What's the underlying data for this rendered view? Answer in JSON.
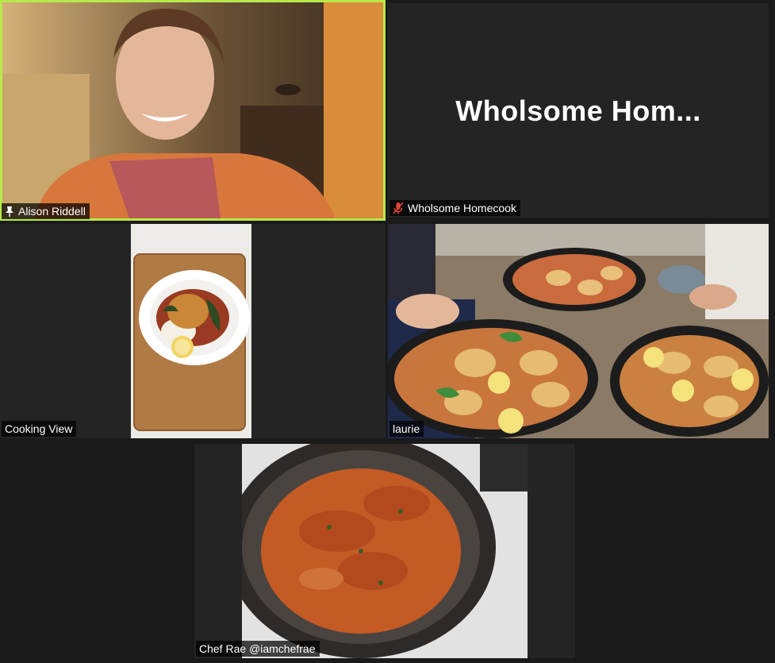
{
  "participants": [
    {
      "name": "Alison Riddell",
      "pinned": true,
      "active_speaker": true,
      "icon": "pin-icon"
    },
    {
      "name": "Wholsome Homecook",
      "placeholder_text": "Wholsome  Hom...",
      "audio_muted": true,
      "icon": "microphone-muted-icon"
    },
    {
      "name": "Cooking View"
    },
    {
      "name": "laurie"
    },
    {
      "name": "Chef Rae @iamchefrae"
    }
  ],
  "colors": {
    "active_speaker_border": "#b8e94a",
    "muted_icon": "#e0443a",
    "tile_background": "#242424",
    "gallery_background": "#1a1a1a"
  }
}
